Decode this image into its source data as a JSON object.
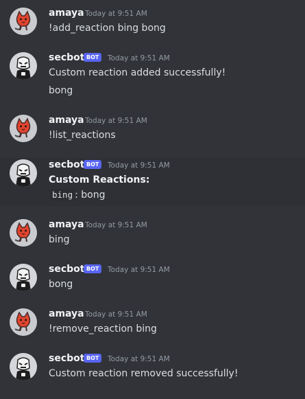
{
  "users": {
    "amaya": "amaya",
    "secbot": "secbot"
  },
  "bot_tag": "BOT",
  "messages": [
    {
      "user": "amaya",
      "timestamp": "Today at 9:51 AM",
      "lines": [
        "!add_reaction bing bong"
      ]
    },
    {
      "user": "secbot",
      "bot": true,
      "timestamp": "Today at 9:51 AM",
      "lines": [
        "Custom reaction added successfully!",
        "bong"
      ]
    },
    {
      "user": "amaya",
      "timestamp": "Today at 9:51 AM",
      "lines": [
        "!list_reactions"
      ]
    },
    {
      "user": "secbot",
      "bot": true,
      "timestamp": "Today at 9:51 AM",
      "heading": "Custom Reactions:",
      "code": "bing",
      "separator": ":",
      "value": "bong"
    },
    {
      "user": "amaya",
      "timestamp": "Today at 9:51 AM",
      "lines": [
        "bing"
      ]
    },
    {
      "user": "secbot",
      "bot": true,
      "timestamp": "Today at 9:51 AM",
      "lines": [
        "bong"
      ]
    },
    {
      "user": "amaya",
      "timestamp": "Today at 9:51 AM",
      "lines": [
        "!remove_reaction bing"
      ]
    },
    {
      "user": "secbot",
      "bot": true,
      "timestamp": "Today at 9:51 AM",
      "lines": [
        "Custom reaction removed successfully!"
      ]
    }
  ],
  "colors": {
    "background": "#313338",
    "hover": "#2e3035",
    "bot_tag": "#5865f2",
    "username": "#f2f3f5",
    "text": "#dbdee1",
    "timestamp": "#949ba4"
  }
}
